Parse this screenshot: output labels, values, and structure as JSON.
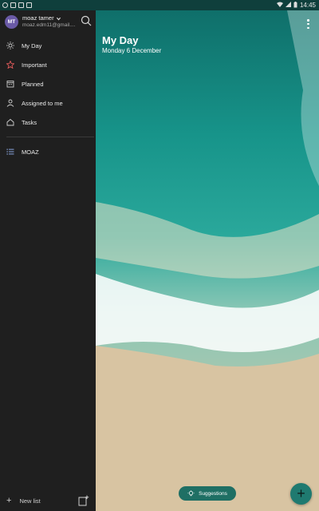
{
  "status_bar": {
    "time": "14:45",
    "icons": [
      "whatsapp-icon",
      "gmail-icon",
      "gmail-icon",
      "image-icon",
      "wifi-icon",
      "signal-icon",
      "battery-icon"
    ]
  },
  "account": {
    "initials": "MT",
    "name": "moaz tamer",
    "email": "moaz.edm11@gmail...."
  },
  "nav": [
    {
      "label": "My Day",
      "icon": "sun-icon"
    },
    {
      "label": "Important",
      "icon": "star-icon"
    },
    {
      "label": "Planned",
      "icon": "calendar-icon"
    },
    {
      "label": "Assigned to me",
      "icon": "person-icon"
    },
    {
      "label": "Tasks",
      "icon": "home-icon"
    }
  ],
  "lists": [
    {
      "label": "MOAZ",
      "icon": "list-icon"
    }
  ],
  "bottom": {
    "new_list": "New list"
  },
  "main": {
    "title": "My Day",
    "date": "Monday 6 December",
    "suggestions": "Suggestions"
  },
  "colors": {
    "accent": "#1f7a70",
    "star": "#e05a5a",
    "sidebar_bg": "#1f1f1f"
  }
}
